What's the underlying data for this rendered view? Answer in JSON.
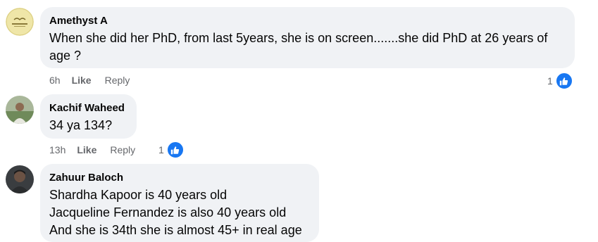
{
  "comments": [
    {
      "author": "Amethyst A",
      "text_lines": [
        "When she did her PhD, from last 5years, she is on screen.......she did PhD at 26 years of",
        "age ?"
      ],
      "time": "6h",
      "like_label": "Like",
      "reply_label": "Reply",
      "reaction_count": "1"
    },
    {
      "author": "Kachif Waheed",
      "text_lines": [
        "34 ya 134?"
      ],
      "time": "13h",
      "like_label": "Like",
      "reply_label": "Reply",
      "reaction_count": "1"
    },
    {
      "author": "Zahuur Baloch",
      "text_lines": [
        "Shardha Kapoor is 40 years old",
        "Jacqueline Fernandez is also 40 years old",
        "And she is 34th she is almost 45+ in real age"
      ]
    }
  ],
  "colors": {
    "bubble": "#f0f2f5",
    "meta_text": "#65676b",
    "like_blue": "#1877f2"
  },
  "icons": [
    "avatar",
    "thumbs-up-icon"
  ]
}
